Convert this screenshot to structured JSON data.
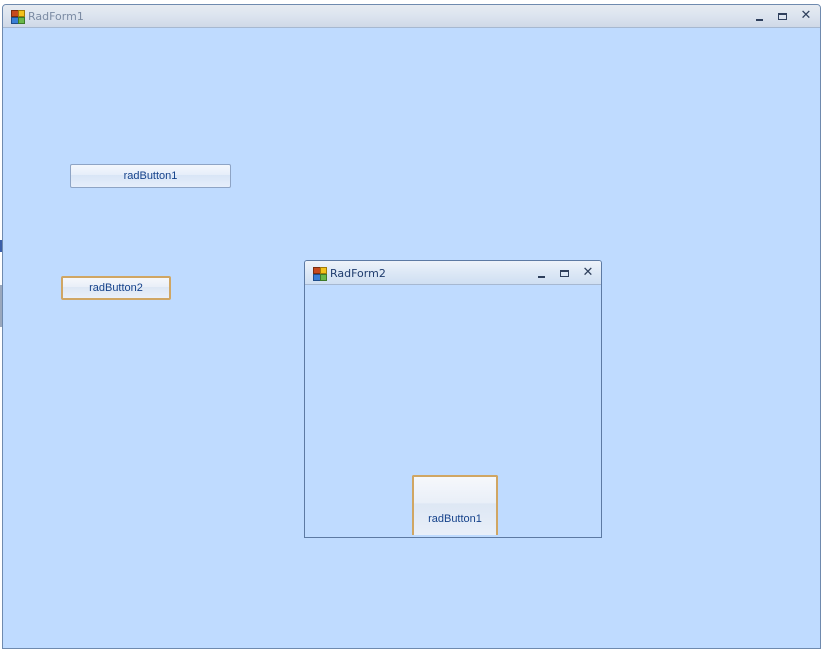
{
  "form1": {
    "title": "RadForm1",
    "icon": "app-form-icon",
    "controls": {
      "minimize": "minimize-icon",
      "maximize": "maximize-icon",
      "close": "✕"
    },
    "buttons": [
      {
        "label": "radButton1"
      },
      {
        "label": "radButton2"
      }
    ]
  },
  "form2": {
    "title": "RadForm2",
    "icon": "app-form-icon",
    "controls": {
      "minimize": "minimize-icon",
      "maximize": "maximize-icon",
      "close": "✕"
    },
    "buttons": [
      {
        "label": "radButton1"
      }
    ]
  },
  "colors": {
    "client_area": "#bfdbff",
    "button_text": "#15428b",
    "focus_border": "#d0a663"
  }
}
